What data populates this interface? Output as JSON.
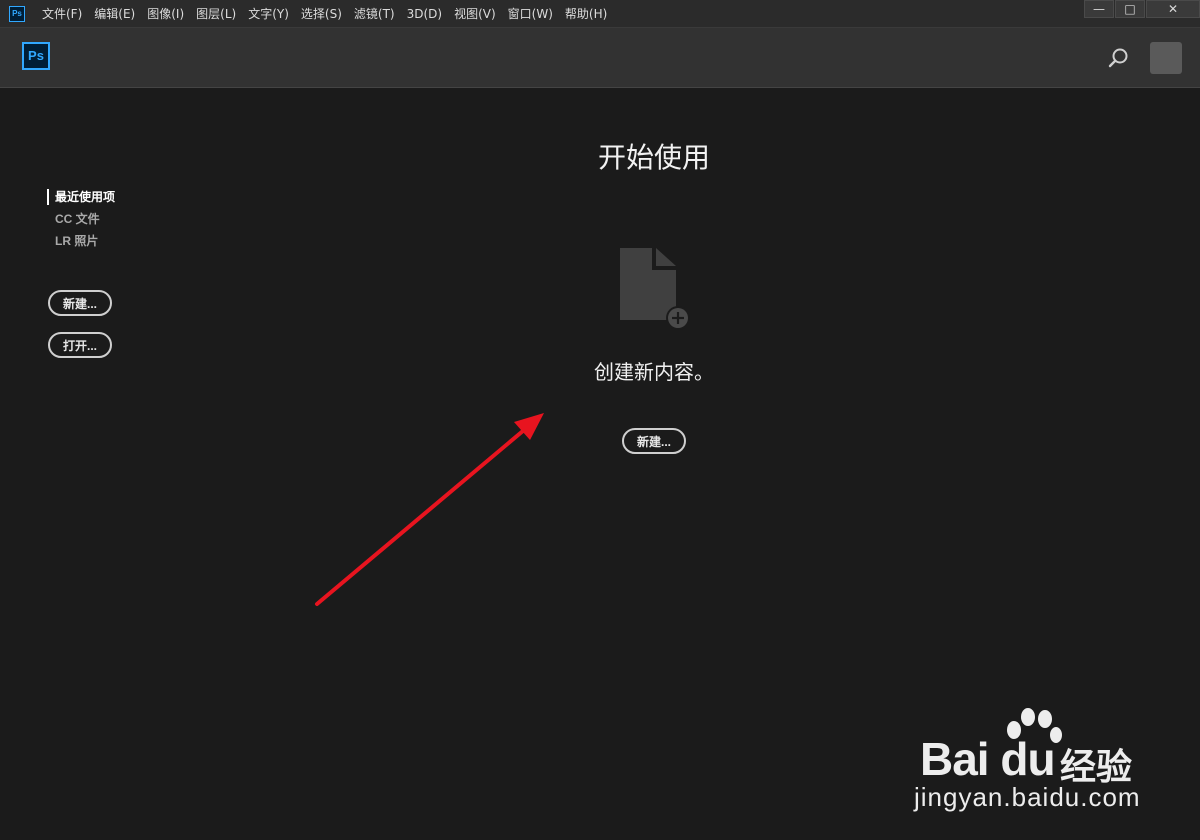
{
  "app": {
    "small_icon_text": "Ps",
    "logo_text": "Ps",
    "brand_color": "#31a8ff",
    "brand_bg": "#001e36"
  },
  "menu": {
    "items": [
      {
        "label": "文件(F)"
      },
      {
        "label": "编辑(E)"
      },
      {
        "label": "图像(I)"
      },
      {
        "label": "图层(L)"
      },
      {
        "label": "文字(Y)"
      },
      {
        "label": "选择(S)"
      },
      {
        "label": "滤镜(T)"
      },
      {
        "label": "3D(D)"
      },
      {
        "label": "视图(V)"
      },
      {
        "label": "窗口(W)"
      },
      {
        "label": "帮助(H)"
      }
    ]
  },
  "window_controls": {
    "minimize": "—",
    "maximize": "□",
    "close": "✕"
  },
  "header": {
    "search_icon": "search-icon",
    "avatar_icon": "avatar"
  },
  "sidebar": {
    "nav": [
      {
        "label": "最近使用项",
        "active": true
      },
      {
        "label": "CC 文件",
        "active": false
      },
      {
        "label": "LR 照片",
        "active": false
      }
    ],
    "new_button": "新建...",
    "open_button": "打开..."
  },
  "main": {
    "title": "开始使用",
    "file_icon": "new-document-icon",
    "create_text": "创建新内容。",
    "new_button": "新建..."
  },
  "annotation": {
    "arrow_color": "#e8141f"
  },
  "watermark": {
    "brand": "Bai du",
    "service": "经验",
    "url": "jingyan.baidu.com"
  }
}
